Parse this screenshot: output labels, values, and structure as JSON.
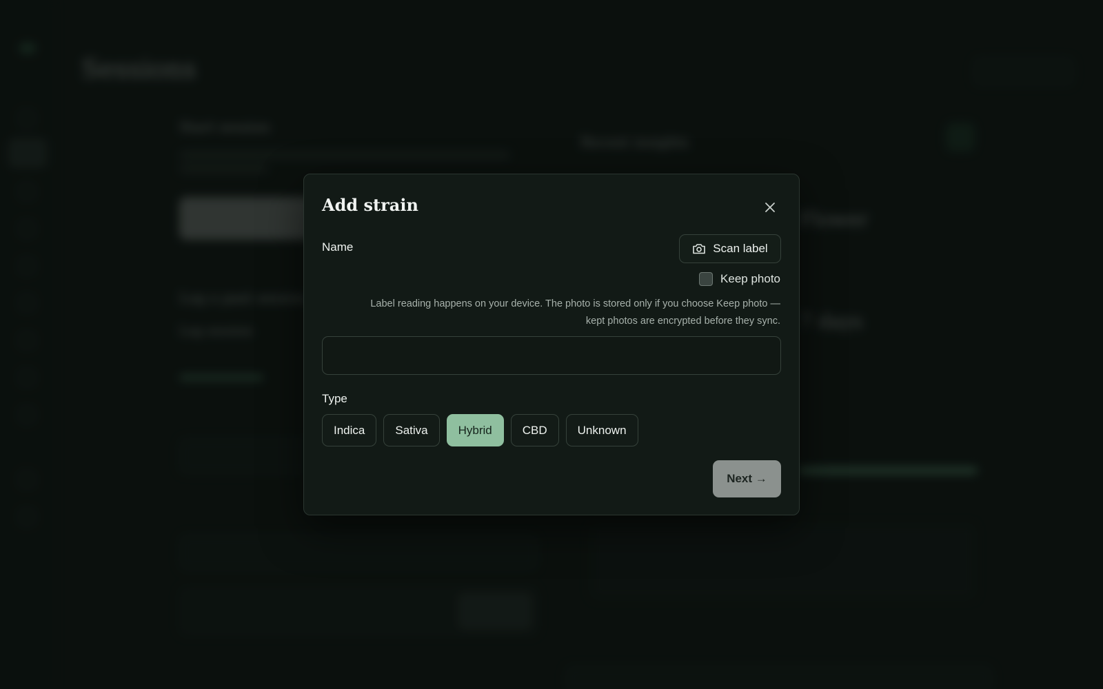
{
  "background": {
    "breadcrumb": "",
    "page_title": "Sessions",
    "top_button": "",
    "start_section": "Start session",
    "log_past_section": "Log a past session",
    "log_session": "Log session",
    "insights_heading": "Recent insights",
    "big_stat_1": "Flower",
    "big_stat_2": "7 days"
  },
  "modal": {
    "title": "Add strain",
    "close_icon": "close-icon",
    "name_label": "Name",
    "scan_button": {
      "icon": "camera-icon",
      "label": "Scan label"
    },
    "keep_photo": {
      "label": "Keep photo",
      "checked": false
    },
    "note": "Label reading happens on your device. The photo is stored only if you choose Keep photo — kept photos are encrypted before they sync.",
    "name_value": "",
    "type_label": "Type",
    "type_options": [
      "Indica",
      "Sativa",
      "Hybrid",
      "CBD",
      "Unknown"
    ],
    "type_selected": "Hybrid",
    "next_button": "Next →"
  },
  "colors": {
    "background": "#0f1512",
    "modal_bg": "#121a16",
    "accent_selected": "#8fbf9f",
    "next_button": "#8b918e"
  }
}
